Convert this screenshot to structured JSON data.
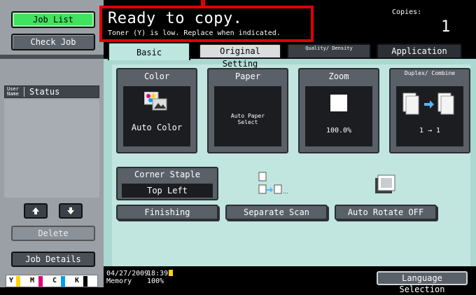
{
  "sidebar": {
    "job_list": "Job List",
    "check_job": "Check Job",
    "col_user_name": "User Name",
    "col_status": "Status",
    "delete": "Delete",
    "job_details": "Job Details",
    "toner": [
      "Y",
      "M",
      "C",
      "K"
    ],
    "toner_colors": [
      "#ffd400",
      "#e0007a",
      "#00a0e9",
      "#000000"
    ]
  },
  "header": {
    "message": "Ready to copy.",
    "submessage": "Toner (Y) is low. Replace when indicated.",
    "copies_label": "Copies:",
    "copies_value": "1"
  },
  "tabs": {
    "basic": "Basic",
    "original_setting": "Original Setting",
    "quality_density": "Quality/ Density",
    "application": "Application"
  },
  "cards": {
    "color": {
      "title": "Color",
      "value": "Auto Color"
    },
    "paper": {
      "title": "Paper",
      "value": "Auto Paper Select"
    },
    "zoom": {
      "title": "Zoom",
      "value": "100.0%"
    },
    "duplex": {
      "title": "Duplex/ Combine",
      "value": "1 → 1"
    }
  },
  "corner_staple": {
    "title": "Corner Staple",
    "value": "Top Left"
  },
  "buttons": {
    "finishing": "Finishing",
    "separate_scan": "Separate Scan",
    "auto_rotate": "Auto Rotate OFF"
  },
  "status": {
    "date": "04/27/2009",
    "memory_label": "Memory",
    "time": "18:39",
    "memory_value": "100%",
    "language_selection": "Language Selection"
  }
}
